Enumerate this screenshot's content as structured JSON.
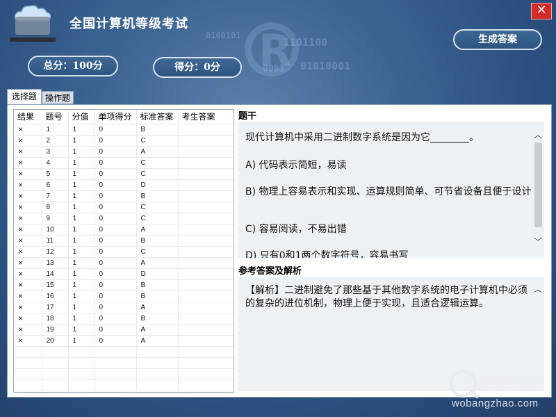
{
  "window": {
    "title": "全国计算机等级考试",
    "close_label": "✕"
  },
  "header": {
    "generate_button": "生成答案",
    "total_score_label": "总分：100分",
    "score_label": "得分：0分",
    "bg_binary": [
      "0100101",
      "1101100",
      "0001",
      "01010001"
    ]
  },
  "tabs": [
    {
      "label": "选择题",
      "active": true
    },
    {
      "label": "操作题",
      "active": false
    }
  ],
  "grid": {
    "columns": [
      "结果",
      "题号",
      "分值",
      "单项得分",
      "标准答案",
      "考生答案"
    ],
    "rows": [
      {
        "result": "×",
        "no": "1",
        "points": "1",
        "item_score": "0",
        "std": "B",
        "student": ""
      },
      {
        "result": "×",
        "no": "2",
        "points": "1",
        "item_score": "0",
        "std": "C",
        "student": ""
      },
      {
        "result": "×",
        "no": "3",
        "points": "1",
        "item_score": "0",
        "std": "A",
        "student": ""
      },
      {
        "result": "×",
        "no": "4",
        "points": "1",
        "item_score": "0",
        "std": "C",
        "student": ""
      },
      {
        "result": "×",
        "no": "5",
        "points": "1",
        "item_score": "0",
        "std": "C",
        "student": ""
      },
      {
        "result": "×",
        "no": "6",
        "points": "1",
        "item_score": "0",
        "std": "D",
        "student": ""
      },
      {
        "result": "×",
        "no": "7",
        "points": "1",
        "item_score": "0",
        "std": "B",
        "student": ""
      },
      {
        "result": "×",
        "no": "8",
        "points": "1",
        "item_score": "0",
        "std": "C",
        "student": ""
      },
      {
        "result": "×",
        "no": "9",
        "points": "1",
        "item_score": "0",
        "std": "C",
        "student": ""
      },
      {
        "result": "×",
        "no": "10",
        "points": "1",
        "item_score": "0",
        "std": "A",
        "student": ""
      },
      {
        "result": "×",
        "no": "11",
        "points": "1",
        "item_score": "0",
        "std": "B",
        "student": ""
      },
      {
        "result": "×",
        "no": "12",
        "points": "1",
        "item_score": "0",
        "std": "C",
        "student": ""
      },
      {
        "result": "×",
        "no": "13",
        "points": "1",
        "item_score": "0",
        "std": "A",
        "student": ""
      },
      {
        "result": "×",
        "no": "14",
        "points": "1",
        "item_score": "0",
        "std": "D",
        "student": ""
      },
      {
        "result": "×",
        "no": "15",
        "points": "1",
        "item_score": "0",
        "std": "B",
        "student": ""
      },
      {
        "result": "×",
        "no": "16",
        "points": "1",
        "item_score": "0",
        "std": "B",
        "student": ""
      },
      {
        "result": "×",
        "no": "17",
        "points": "1",
        "item_score": "0",
        "std": "A",
        "student": ""
      },
      {
        "result": "×",
        "no": "18",
        "points": "1",
        "item_score": "0",
        "std": "B",
        "student": ""
      },
      {
        "result": "×",
        "no": "19",
        "points": "1",
        "item_score": "0",
        "std": "A",
        "student": ""
      },
      {
        "result": "×",
        "no": "20",
        "points": "1",
        "item_score": "0",
        "std": "A",
        "student": ""
      }
    ],
    "empty_rows": 4
  },
  "question": {
    "section_label": "题干",
    "stem": "现代计算机中采用二进制数字系统是因为它________。",
    "options": [
      "A) 代码表示简短，易读",
      "B) 物理上容易表示和实现、运算规则简单、可节省设备且便于设计",
      "C) 容易阅读，不易出错",
      "D) 只有0和1两个数字符号，容易书写"
    ]
  },
  "answer": {
    "section_label": "参考答案及解析",
    "text": "【解析】二进制避免了那些基于其他数字系统的电子计算机中必须的复杂的进位机制，物理上便于实现，且适合逻辑运算。"
  },
  "watermark": {
    "cn": "我帮找网",
    "en": "wobangzhao.com"
  },
  "colors": {
    "background": "#2b5181",
    "close": "#d42a2a",
    "wrong_mark": "#e02020"
  }
}
